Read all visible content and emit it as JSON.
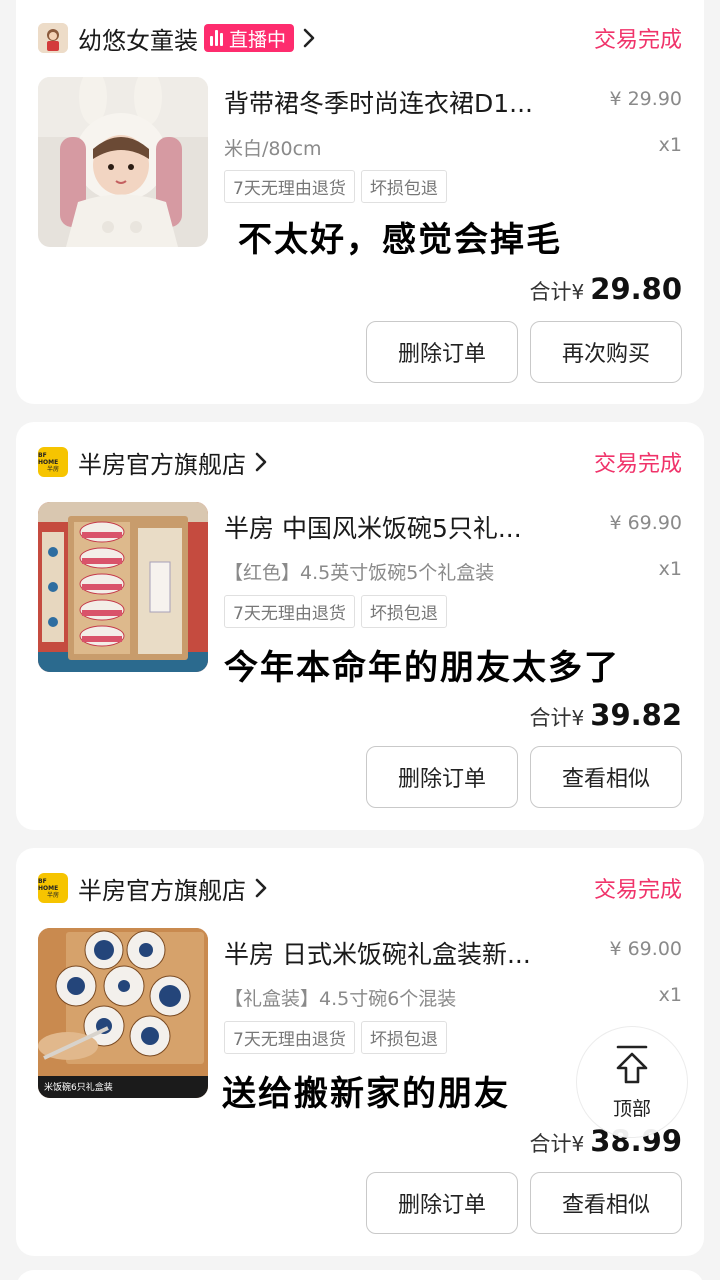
{
  "orders": [
    {
      "shop_name": "幼悠女童装",
      "live_badge": "直播中",
      "status": "交易完成",
      "product_title": "背带裙冬季时尚连衣裙D1...",
      "price": "¥ 29.90",
      "spec": "米白/80cm",
      "quantity": "x1",
      "tags": [
        "7天无理由退货",
        "坏损包退"
      ],
      "note": "不太好，感觉会掉毛",
      "total_label": "合计",
      "total_currency": "¥",
      "total_amount": "29.80",
      "buttons": [
        "删除订单",
        "再次购买"
      ]
    },
    {
      "shop_name": "半房官方旗舰店",
      "shop_logo_text": [
        "BF HOME",
        "半房"
      ],
      "status": "交易完成",
      "product_title": "半房 中国风米饭碗5只礼...",
      "price": "¥ 69.90",
      "spec": "【红色】4.5英寸饭碗5个礼盒装",
      "quantity": "x1",
      "tags": [
        "7天无理由退货",
        "坏损包退"
      ],
      "note": "今年本命年的朋友太多了",
      "total_label": "合计",
      "total_currency": "¥",
      "total_amount": "39.82",
      "buttons": [
        "删除订单",
        "查看相似"
      ]
    },
    {
      "shop_name": "半房官方旗舰店",
      "shop_logo_text": [
        "BF HOME",
        "半房"
      ],
      "status": "交易完成",
      "product_title": "半房 日式米饭碗礼盒装新...",
      "price": "¥ 69.00",
      "spec": "【礼盒装】4.5寸碗6个混装",
      "quantity": "x1",
      "tags": [
        "7天无理由退货",
        "坏损包退"
      ],
      "note": "送给搬新家的朋友",
      "total_label": "合计",
      "total_currency": "¥",
      "total_amount": "38.99",
      "buttons": [
        "删除订单",
        "查看相似"
      ],
      "image_caption": "米饭碗6只礼盒装"
    }
  ],
  "back_to_top": "顶部",
  "colors": {
    "status": "#f0336a",
    "live_badge": "#fe2c6e",
    "bf_logo": "#f6c400"
  }
}
